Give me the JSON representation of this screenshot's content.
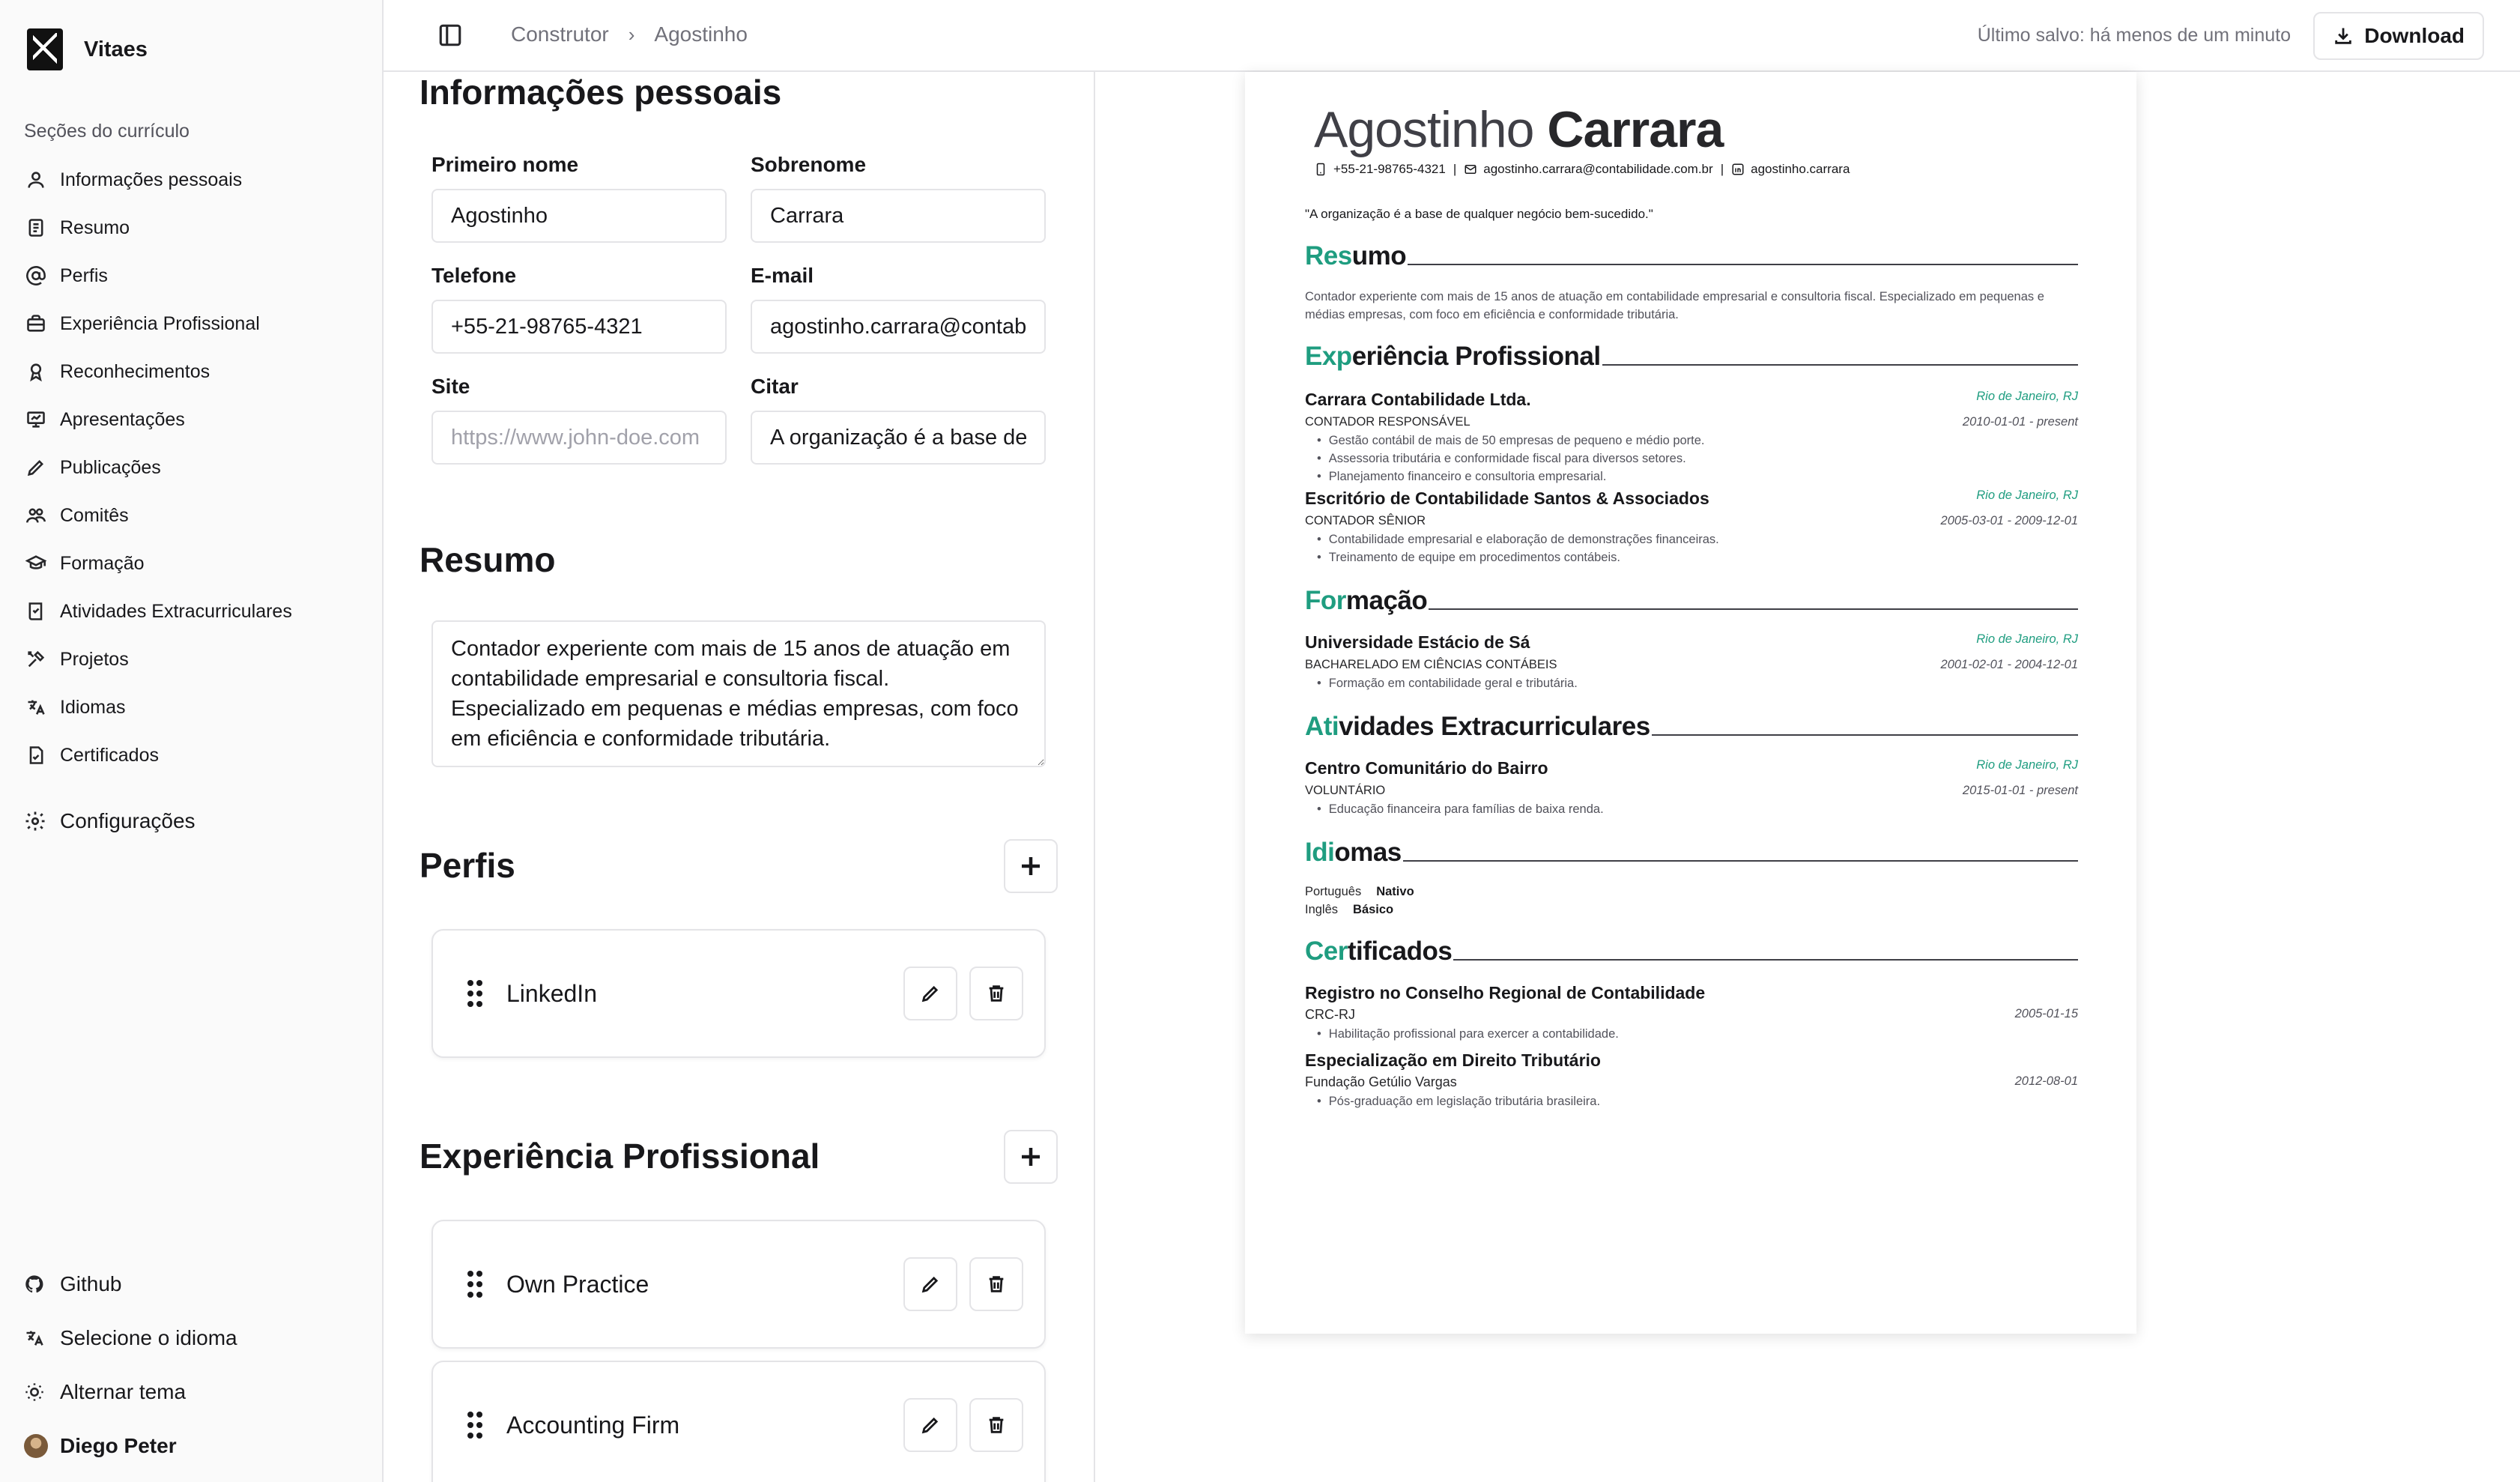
{
  "app": {
    "name": "Vitaes"
  },
  "sidebar": {
    "section_title": "Seções do currículo",
    "items": [
      {
        "label": "Informações pessoais",
        "icon": "user-icon"
      },
      {
        "label": "Resumo",
        "icon": "file-text-icon"
      },
      {
        "label": "Perfis",
        "icon": "at-sign-icon"
      },
      {
        "label": "Experiência Profissional",
        "icon": "briefcase-icon"
      },
      {
        "label": "Reconhecimentos",
        "icon": "award-icon"
      },
      {
        "label": "Apresentações",
        "icon": "presentation-icon"
      },
      {
        "label": "Publicações",
        "icon": "pencil-icon"
      },
      {
        "label": "Comitês",
        "icon": "users-icon"
      },
      {
        "label": "Formação",
        "icon": "graduation-cap-icon"
      },
      {
        "label": "Atividades Extracurriculares",
        "icon": "book-check-icon"
      },
      {
        "label": "Projetos",
        "icon": "tools-icon"
      },
      {
        "label": "Idiomas",
        "icon": "languages-icon"
      },
      {
        "label": "Certificados",
        "icon": "file-badge-icon"
      }
    ],
    "config_label": "Configurações",
    "bottom": {
      "github": "Github",
      "language": "Selecione o idioma",
      "theme": "Alternar tema",
      "user": "Diego Peter"
    }
  },
  "header": {
    "breadcrumb": [
      "Construtor",
      "Agostinho"
    ],
    "saved_status": "Último salvo: há menos de um minuto",
    "download_label": "Download"
  },
  "editor": {
    "personal": {
      "title": "Informações pessoais",
      "first_name_label": "Primeiro nome",
      "first_name_value": "Agostinho",
      "last_name_label": "Sobrenome",
      "last_name_value": "Carrara",
      "phone_label": "Telefone",
      "phone_value": "+55-21-98765-4321",
      "email_label": "E-mail",
      "email_value": "agostinho.carrara@contab",
      "site_label": "Site",
      "site_placeholder": "https://www.john-doe.com",
      "quote_label": "Citar",
      "quote_value": "A organização é a base de"
    },
    "summary": {
      "title": "Resumo",
      "text": "Contador experiente com mais de 15 anos de atuação em contabilidade empresarial e consultoria fiscal. Especializado em pequenas e médias empresas, com foco em eficiência e conformidade tributária."
    },
    "profiles": {
      "title": "Perfis",
      "items": [
        "LinkedIn"
      ]
    },
    "experience": {
      "title": "Experiência Profissional",
      "items": [
        "Own Practice",
        "Accounting Firm"
      ]
    }
  },
  "resume": {
    "first_name": "Agostinho",
    "last_name": "Carrara",
    "phone": "+55-21-98765-4321",
    "email": "agostinho.carrara@contabilidade.com.br",
    "linkedin": "agostinho.carrara",
    "separator": "|",
    "quote": "\"A organização é a base de qualquer negócio bem-sucedido.\"",
    "accent_color": "#1f9d80",
    "sections": {
      "summary": {
        "accent": "Res",
        "rest": "umo"
      },
      "experience": {
        "accent": "Exp",
        "rest": "eriência Profissional"
      },
      "education": {
        "accent": "For",
        "rest": "mação"
      },
      "extracurricular": {
        "accent": "Ati",
        "rest": "vidades Extracurriculares"
      },
      "languages": {
        "accent": "Idi",
        "rest": "omas"
      },
      "certificates": {
        "accent": "Cer",
        "rest": "tificados"
      }
    },
    "summary_text": "Contador experiente com mais de 15 anos de atuação em contabilidade empresarial e consultoria fiscal. Especializado em pequenas e médias empresas, com foco em eficiência e conformidade tributária.",
    "experience": [
      {
        "org": "Carrara Contabilidade Ltda.",
        "role": "Contador Responsável",
        "location": "Rio de Janeiro, RJ",
        "dates": "2010-01-01 - present",
        "bullets": [
          "Gestão contábil de mais de 50 empresas de pequeno e médio porte.",
          "Assessoria tributária e conformidade fiscal para diversos setores.",
          "Planejamento financeiro e consultoria empresarial."
        ]
      },
      {
        "org": "Escritório de Contabilidade Santos & Associados",
        "role": "Contador Sênior",
        "location": "Rio de Janeiro, RJ",
        "dates": "2005-03-01 - 2009-12-01",
        "bullets": [
          "Contabilidade empresarial e elaboração de demonstrações financeiras.",
          "Treinamento de equipe em procedimentos contábeis."
        ]
      }
    ],
    "education": [
      {
        "org": "Universidade Estácio de Sá",
        "role": "Bacharelado em Ciências Contábeis",
        "location": "Rio de Janeiro, RJ",
        "dates": "2001-02-01 - 2004-12-01",
        "bullets": [
          "Formação em contabilidade geral e tributária."
        ]
      }
    ],
    "extracurricular": [
      {
        "org": "Centro Comunitário do Bairro",
        "role": "Voluntário",
        "location": "Rio de Janeiro, RJ",
        "dates": "2015-01-01 - present",
        "bullets": [
          "Educação financeira para famílias de baixa renda."
        ]
      }
    ],
    "languages": [
      {
        "name": "Português",
        "level": "Nativo"
      },
      {
        "name": "Inglês",
        "level": "Básico"
      }
    ],
    "certificates": [
      {
        "name": "Registro no Conselho Regional de Contabilidade",
        "issuer": "CRC-RJ",
        "date": "2005-01-15",
        "bullets": [
          "Habilitação profissional para exercer a contabilidade."
        ]
      },
      {
        "name": "Especialização em Direito Tributário",
        "issuer": "Fundação Getúlio Vargas",
        "date": "2012-08-01",
        "bullets": [
          "Pós-graduação em legislação tributária brasileira."
        ]
      }
    ]
  }
}
